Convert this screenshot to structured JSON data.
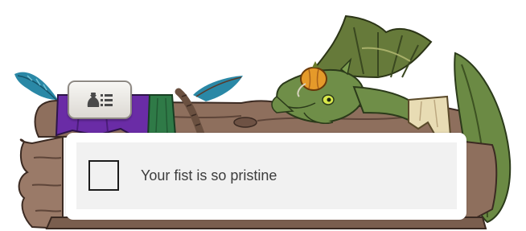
{
  "tab": {
    "icon": "item-bag-list-icon"
  },
  "notice": {
    "message": "Your fist is so pristine",
    "checkbox_checked": false
  },
  "colors": {
    "panel_bg": "#ffffff",
    "panel_inner_bg": "#f1f1f1",
    "text": "#3c3c3c",
    "log_wood": "#8a6c5a",
    "dragon_green": "#6f8e48",
    "drape_purple": "#6a2ca6"
  }
}
